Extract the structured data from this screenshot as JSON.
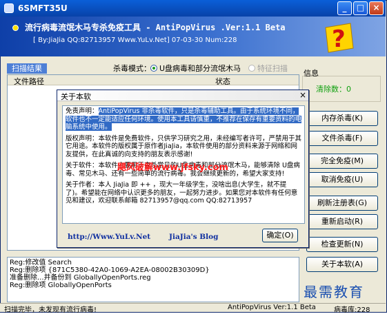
{
  "window": {
    "title": "6SMFT35U",
    "buttons": [
      "_",
      "□",
      "×"
    ]
  },
  "banner": {
    "title": "流行病毒流氓木马专杀免疫工具 - AntiPopVirus .Ver:1.1 Beta",
    "subtitle": "[ By:JiaJia QQ:82713957 Www.YuLv.Net] 07-03-30 Num:228"
  },
  "scan": {
    "tab_label": "扫描结果",
    "kill_mode_label": "杀毒模式：",
    "option_usb": "U盘病毒和部分流氓木马",
    "option_feature": "特征扫描",
    "col_path": "文件路径",
    "col_status": "状态"
  },
  "log": {
    "lines": [
      "Reg:修改值 Search",
      "Reg:删除项 {871C5380-42A0-1069-A2EA-08002B30309D}",
      "准备删除...并备份到 GloballyOpenPorts.reg",
      "Reg:删除项 GloballyOpenPorts"
    ]
  },
  "info": {
    "label": "信息",
    "cleaned": "清除数：0"
  },
  "buttons": {
    "memory_kill": "内存杀毒(K)",
    "file_kill": "文件杀毒(F)",
    "full_immune": "完全免疫(M)",
    "cancel_immune": "取消免疫(U)",
    "refresh_reg": "刷新注册表(G)",
    "restart": "重新启动(R)",
    "check_update": "检查更新(N)",
    "about": "关于本软(A)"
  },
  "watermark": "最需教育",
  "statusbar": {
    "left": "扫描完毕，未发现有流行病毒!",
    "middle": "AntiPopVirus Ver:1.1 Beta",
    "right": "病毒库:228"
  },
  "about_dialog": {
    "title": "关于本软",
    "close": "×",
    "disclaimer_label": "免责声明：",
    "disclaimer_text": "AntiPopVirus 非杀毒软件，只是杀毒辅助工具。由于系统环境不同，软件也不一定能适应任何环境。使用本工具请慎重，不推荐在保存有重要资料的电脑系统中使用。",
    "copyright_text": "版权声明：本软件是免费软件，只供学习研究之用，未经编写者许可，严禁用于其它用途。本软件的版权属于原作者JiaJia，本软件使用的部分资料来源于网络和网友提供，在此真诚的向支持的朋友表示感谢!",
    "about_software_text": "关于软件：本软件主要用于查杀常见的U盘病毒和部分流氓木马，能够清除 U盘病毒、常见木马、还有一些简单的流行病毒。我会继续更新的，希望大家支持!",
    "about_author_text": "关于作者：本人 JiaJia 即 ++ ，现大一年级学生，没啥出息(大学生，就不提了)。希望能在网络中认识更多的朋友，一起努力进步。如果您对本软件有任何意见和建议，欢迎联系邮箱 82713957@qq.com QQ:82713957",
    "stamp": "飓风破解www.jfsky.com",
    "link_home": "http://Www.YuLv.Net",
    "link_blog": "JiaJia's Blog",
    "ok_button": "确定(O)"
  },
  "colors": {
    "title_bar": "#0a5fd8",
    "banner": "#0e3fa8",
    "highlight": "#316ac5",
    "cleaned_text": "#10a010",
    "stamp_red": "#ff1a1a"
  }
}
